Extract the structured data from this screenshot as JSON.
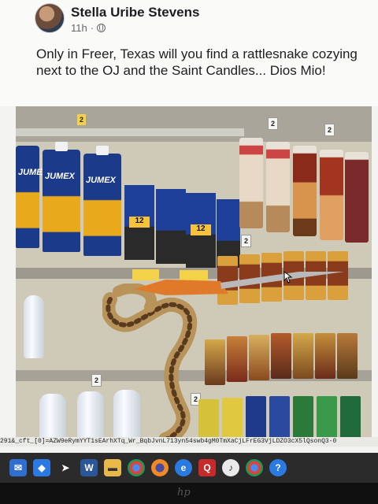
{
  "post": {
    "author": "Stella Uribe Stevens",
    "time": "11h",
    "separator": "·",
    "caption": "Only in Freer, Texas will you find a rattlesnake cozying next to the OJ and the Saint Candles... Dios Mio!"
  },
  "photo": {
    "juice_label": "JUMEX",
    "pack_label": "12",
    "price_tags": [
      "2",
      "2",
      "2",
      "2",
      "2",
      "2"
    ]
  },
  "browser": {
    "url_fragment": "291&_cft_[0]=AZW9eRymYYT1sEArhXTq_Wr_BqbJvnL713yn54swb4gM0TmXaCjLFrEG3VjLDZO3cX5lQsonQ3-0"
  },
  "taskbar": {
    "icons": [
      "mail-icon",
      "dropbox-icon",
      "cursor-app-icon",
      "word-icon",
      "folder-icon",
      "chrome-icon",
      "firefox-icon",
      "ie-icon",
      "quicken-icon",
      "music-icon",
      "chrome2-icon",
      "help-icon"
    ]
  },
  "monitor": {
    "brand": "hp"
  }
}
